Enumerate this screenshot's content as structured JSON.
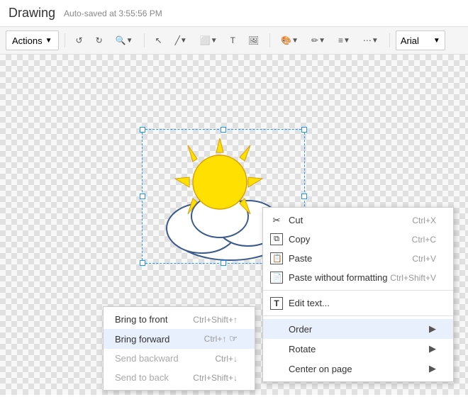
{
  "app": {
    "title": "Drawing",
    "autosave": "Auto-saved at 3:55:56 PM"
  },
  "toolbar": {
    "actions_label": "Actions",
    "font_label": "Arial"
  },
  "context_menu": {
    "items": [
      {
        "id": "cut",
        "label": "Cut",
        "shortcut": "Ctrl+X",
        "icon": "✂",
        "disabled": false
      },
      {
        "id": "copy",
        "label": "Copy",
        "shortcut": "Ctrl+C",
        "icon": "⧉",
        "disabled": false
      },
      {
        "id": "paste",
        "label": "Paste",
        "shortcut": "Ctrl+V",
        "icon": "📋",
        "disabled": false
      },
      {
        "id": "paste-no-format",
        "label": "Paste without formatting",
        "shortcut": "Ctrl+Shift+V",
        "icon": "📄",
        "disabled": false
      },
      {
        "id": "edit-text",
        "label": "Edit text...",
        "icon": "T",
        "disabled": false
      },
      {
        "id": "order",
        "label": "Order",
        "icon": "",
        "hasArrow": true,
        "highlighted": true
      },
      {
        "id": "rotate",
        "label": "Rotate",
        "icon": "",
        "hasArrow": true
      },
      {
        "id": "center-on-page",
        "label": "Center on page",
        "icon": "",
        "hasArrow": true
      }
    ]
  },
  "submenu_order": {
    "items": [
      {
        "id": "bring-to-front",
        "label": "Bring to front",
        "shortcut": "Ctrl+Shift+↑",
        "disabled": false
      },
      {
        "id": "bring-forward",
        "label": "Bring forward",
        "shortcut": "Ctrl+↑",
        "disabled": false,
        "active": true
      },
      {
        "id": "send-backward",
        "label": "Send backward",
        "shortcut": "Ctrl+↓",
        "disabled": true
      },
      {
        "id": "send-to-back",
        "label": "Send to back",
        "shortcut": "Ctrl+Shift+↓",
        "disabled": true
      }
    ]
  }
}
